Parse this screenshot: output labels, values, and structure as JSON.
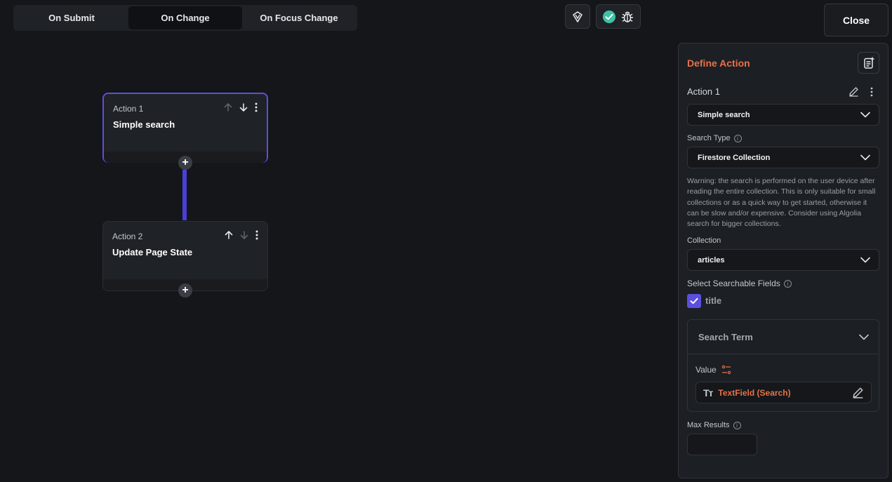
{
  "tabs": [
    {
      "label": "On Submit",
      "active": false
    },
    {
      "label": "On Change",
      "active": true
    },
    {
      "label": "On Focus Change",
      "active": false
    }
  ],
  "toolbar": {
    "close_label": "Close",
    "icons": [
      "tag-edit-icon",
      "check-circle-icon",
      "bug-icon"
    ],
    "accent": "#3fc1a5"
  },
  "actions": [
    {
      "number_label": "Action 1",
      "name": "Simple search",
      "selected": true
    },
    {
      "number_label": "Action 2",
      "name": "Update Page State",
      "selected": false
    }
  ],
  "panel": {
    "title": "Define Action",
    "action_label": "Action 1",
    "action_type": "Simple search",
    "search_type_label": "Search Type",
    "search_type_value": "Firestore Collection",
    "warning": "Warning: the search is performed on the user device after reading the entire collection. This is only suitable for small collections or as a quick way to get started, otherwise it can be slow and/or expensive. Consider using Algolia search for bigger collections.",
    "collection_label": "Collection",
    "collection_value": "articles",
    "searchable_fields_label": "Select Searchable Fields",
    "searchable_fields": [
      {
        "name": "title",
        "checked": true
      }
    ],
    "search_term_label": "Search Term",
    "value_label": "Value",
    "value_source": "TextField (Search)",
    "max_results_label": "Max Results",
    "max_results_value": ""
  },
  "colors": {
    "accent_orange": "#e8714a",
    "accent_purple": "#5b4fe0",
    "background": "#14161a"
  }
}
